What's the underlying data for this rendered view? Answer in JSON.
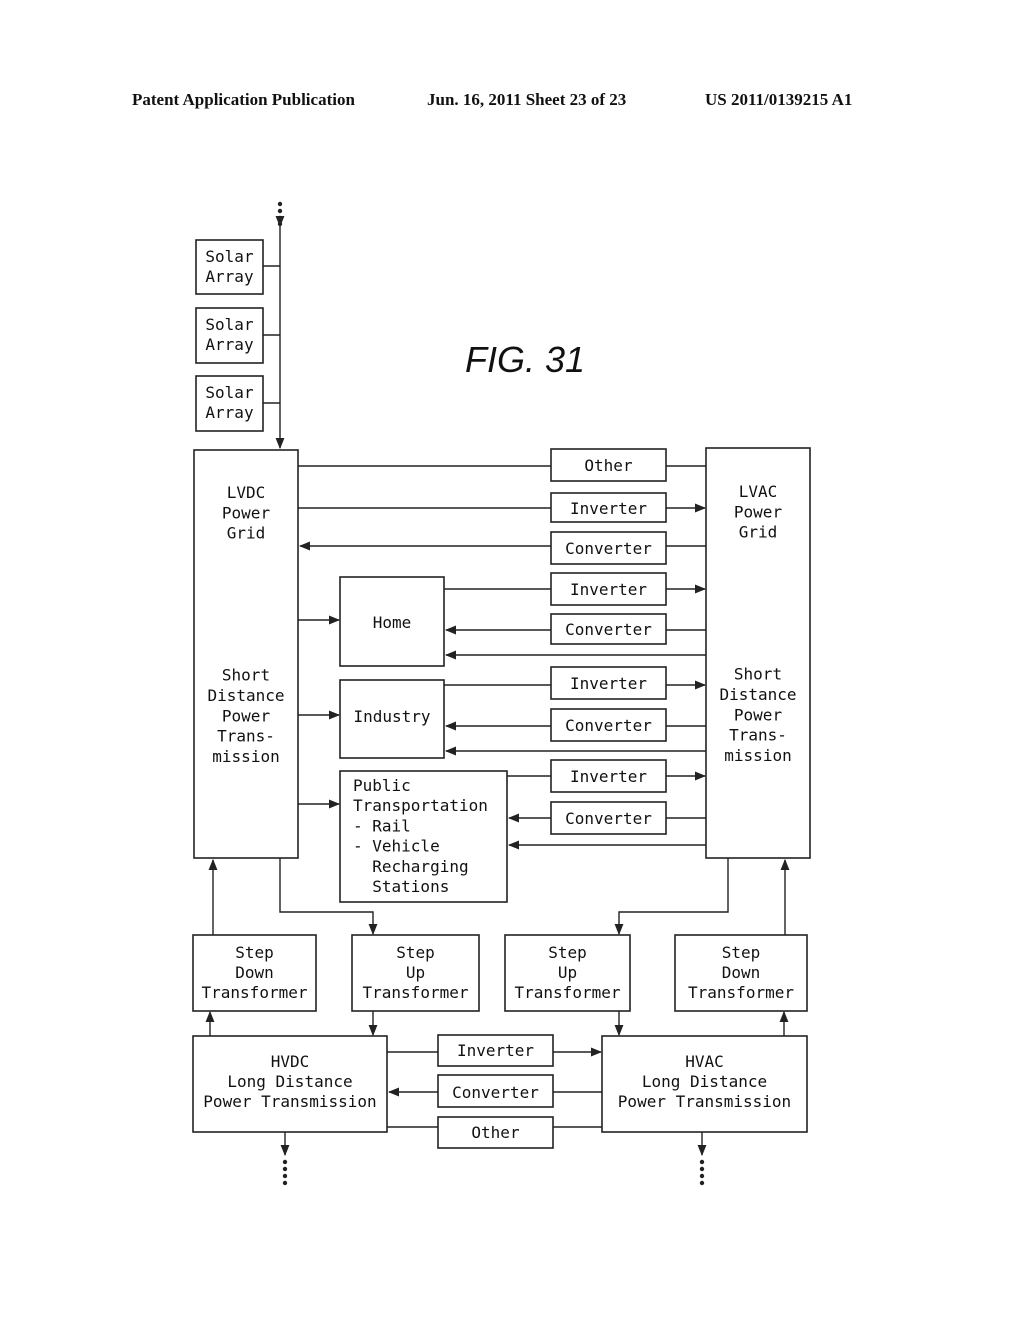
{
  "header": {
    "publication": "Patent Application Publication",
    "date_sheet": "Jun. 16, 2011  Sheet 23 of 23",
    "number": "US 2011/0139215 A1"
  },
  "figure_label": "FIG. 31",
  "blocks": {
    "solar1": [
      "Solar",
      "Array"
    ],
    "solar2": [
      "Solar",
      "Array"
    ],
    "solar3": [
      "Solar",
      "Array"
    ],
    "lvdc": [
      "LVDC",
      "Power",
      "Grid",
      "",
      "",
      "",
      "",
      "",
      "",
      "Short",
      "Distance",
      "Power",
      "Trans-",
      "mission"
    ],
    "lvac": [
      "LVAC",
      "Power",
      "Grid",
      "",
      "",
      "",
      "",
      "",
      "",
      "Short",
      "Distance",
      "Power",
      "Trans-",
      "mission"
    ],
    "home": [
      "Home"
    ],
    "industry": [
      "Industry"
    ],
    "public": [
      "Public",
      "Transportation",
      "- Rail",
      "- Vehicle",
      "  Recharging",
      "  Stations"
    ],
    "top_other": [
      "Other"
    ],
    "top_inverter": [
      "Inverter"
    ],
    "top_converter": [
      "Converter"
    ],
    "home_inverter": [
      "Inverter"
    ],
    "home_converter": [
      "Converter"
    ],
    "ind_inverter": [
      "Inverter"
    ],
    "ind_converter": [
      "Converter"
    ],
    "pub_inverter": [
      "Inverter"
    ],
    "pub_converter": [
      "Converter"
    ],
    "sd_left": [
      "Step",
      "Down",
      "Transformer"
    ],
    "su_left": [
      "Step",
      "Up",
      "Transformer"
    ],
    "su_right": [
      "Step",
      "Up",
      "Transformer"
    ],
    "sd_right": [
      "Step",
      "Down",
      "Transformer"
    ],
    "hvdc": [
      "HVDC",
      "Long Distance",
      "Power Transmission"
    ],
    "hvac": [
      "HVAC",
      "Long Distance",
      "Power Transmission"
    ],
    "bot_inverter": [
      "Inverter"
    ],
    "bot_converter": [
      "Converter"
    ],
    "bot_other": [
      "Other"
    ]
  }
}
